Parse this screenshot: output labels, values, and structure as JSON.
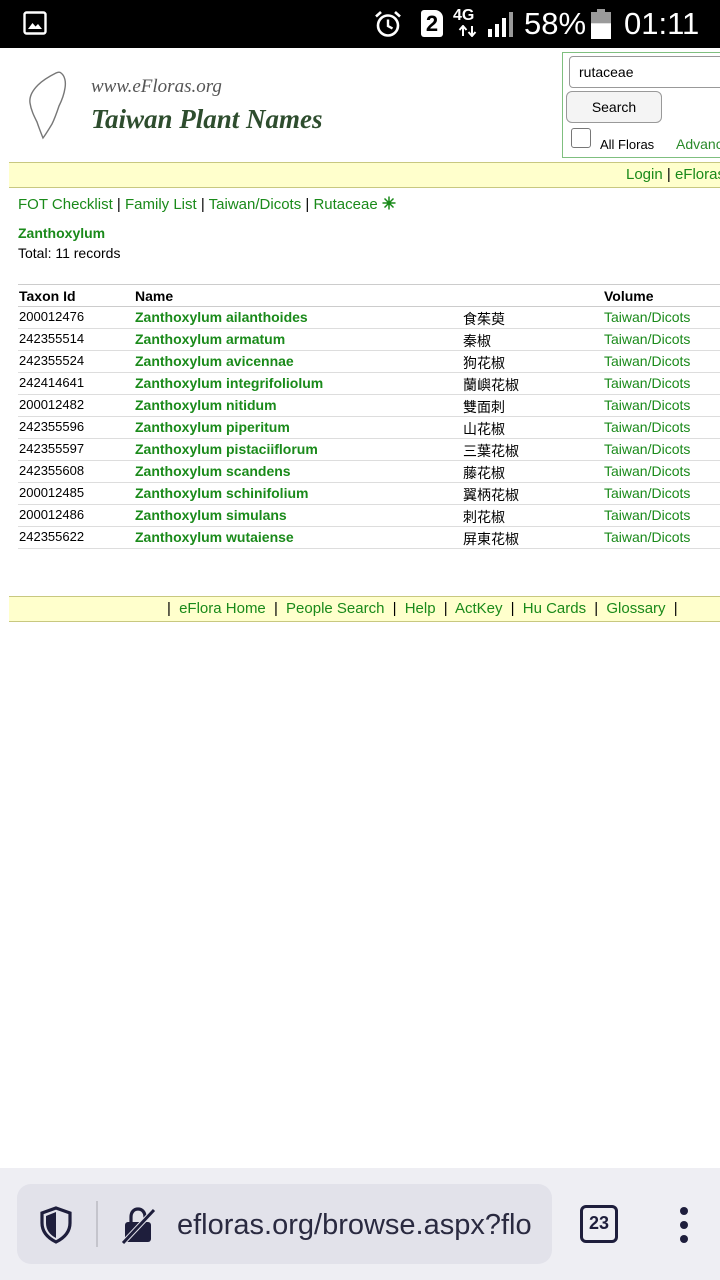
{
  "status_bar": {
    "sim_slot": "2",
    "network": "4G",
    "battery": "58%",
    "battery_level": 0.58,
    "time": "01:11"
  },
  "header": {
    "url_text": "www.eFloras.org",
    "site_title": "Taiwan Plant Names",
    "search_value": "rutaceae",
    "search_button": "Search",
    "all_floras_label": "All Floras",
    "all_floras_checked": false,
    "advanced_label": "Advanc"
  },
  "login_bar": {
    "login": "Login",
    "sep": "|",
    "efloras": "eFloras"
  },
  "breadcrumb": {
    "items": [
      "FOT Checklist",
      "Family List",
      "Taiwan/Dicots",
      "Rutaceae"
    ],
    "sep": "|"
  },
  "genus": "Zanthoxylum",
  "total": "Total: 11 records",
  "table": {
    "headers": {
      "taxon_id": "Taxon Id",
      "name": "Name",
      "volume": "Volume"
    },
    "rows": [
      {
        "id": "200012476",
        "name": "Zanthoxylum ailanthoides",
        "cn": "食茱萸",
        "volume": "Taiwan/Dicots"
      },
      {
        "id": "242355514",
        "name": "Zanthoxylum armatum",
        "cn": "秦椒",
        "volume": "Taiwan/Dicots"
      },
      {
        "id": "242355524",
        "name": "Zanthoxylum avicennae",
        "cn": "狗花椒",
        "volume": "Taiwan/Dicots"
      },
      {
        "id": "242414641",
        "name": "Zanthoxylum integrifoliolum",
        "cn": "蘭嶼花椒",
        "volume": "Taiwan/Dicots"
      },
      {
        "id": "200012482",
        "name": "Zanthoxylum nitidum",
        "cn": "雙面刺",
        "volume": "Taiwan/Dicots"
      },
      {
        "id": "242355596",
        "name": "Zanthoxylum piperitum",
        "cn": "山花椒",
        "volume": "Taiwan/Dicots"
      },
      {
        "id": "242355597",
        "name": "Zanthoxylum pistaciiflorum",
        "cn": "三葉花椒",
        "volume": "Taiwan/Dicots"
      },
      {
        "id": "242355608",
        "name": "Zanthoxylum scandens",
        "cn": "藤花椒",
        "volume": "Taiwan/Dicots"
      },
      {
        "id": "200012485",
        "name": "Zanthoxylum schinifolium",
        "cn": "翼柄花椒",
        "volume": "Taiwan/Dicots"
      },
      {
        "id": "200012486",
        "name": "Zanthoxylum simulans",
        "cn": "刺花椒",
        "volume": "Taiwan/Dicots"
      },
      {
        "id": "242355622",
        "name": "Zanthoxylum wutaiense",
        "cn": "屏東花椒",
        "volume": "Taiwan/Dicots"
      }
    ]
  },
  "footer": {
    "sep": "|",
    "links": [
      "eFlora Home",
      "People Search",
      "Help",
      "ActKey",
      "Hu Cards",
      "Glossary"
    ]
  },
  "browser": {
    "url": "efloras.org/browse.aspx?flo",
    "tab_count": "23"
  },
  "colors": {
    "link_green": "#1a8a1a",
    "bar_yellow": "#ffffcc",
    "status_bar": "#000000"
  }
}
